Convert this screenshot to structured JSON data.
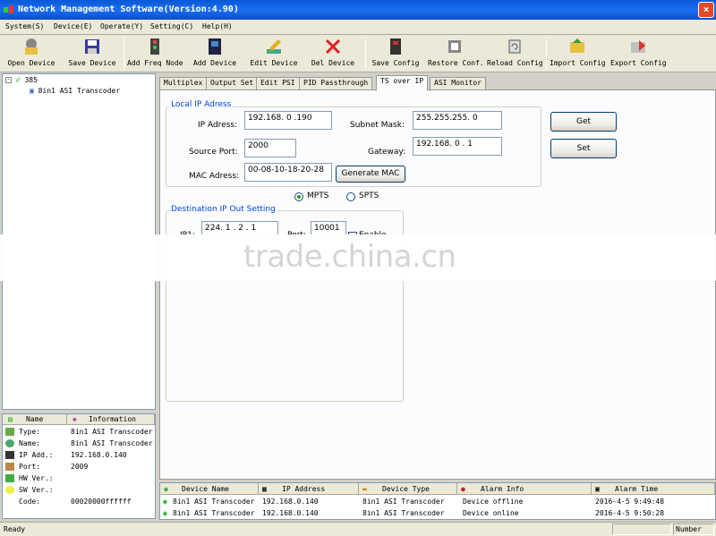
{
  "window": {
    "title": "Network Management Software(Version:4.90)"
  },
  "menu": [
    "System(S)",
    "Device(E)",
    "Operate(Y)",
    "Setting(C)",
    "Help(H)"
  ],
  "toolbar": [
    {
      "label": "Open Device",
      "icon": "folder-open-icon"
    },
    {
      "label": "Save Device",
      "icon": "floppy-disk-icon"
    },
    {
      "label": "Add Freq Node",
      "icon": "add-node-icon"
    },
    {
      "label": "Add Device",
      "icon": "add-device-icon"
    },
    {
      "label": "Edit Device",
      "icon": "edit-icon"
    },
    {
      "label": "Del Device",
      "icon": "delete-x-icon"
    },
    {
      "label": "Save Config",
      "icon": "save-config-icon"
    },
    {
      "label": "Restore Conf.",
      "icon": "restore-icon"
    },
    {
      "label": "Reload Config",
      "icon": "reload-icon"
    },
    {
      "label": "Import Config",
      "icon": "import-folder-icon"
    },
    {
      "label": "Export Config",
      "icon": "export-icon"
    }
  ],
  "tree": {
    "root": "385",
    "child": "8in1 ASI Transcoder"
  },
  "info": {
    "headers": [
      "Name",
      "Information"
    ],
    "rows": [
      {
        "key": "Type:",
        "value": "8in1 ASI Transcoder"
      },
      {
        "key": "Name:",
        "value": "8in1 ASI Transcoder"
      },
      {
        "key": "IP Add.:",
        "value": "192.168.0.140"
      },
      {
        "key": "Port:",
        "value": "2009"
      },
      {
        "key": "HW Ver.:",
        "value": ""
      },
      {
        "key": "SW Ver.:",
        "value": ""
      },
      {
        "key": "Code:",
        "value": "00020000ffffff"
      }
    ]
  },
  "tabs": [
    "Multiplex",
    "Output Set",
    "Edit PSI",
    "PID Passthrough",
    "TS over IP",
    "ASI Monitor"
  ],
  "local_ip": {
    "group_label": "Local IP Adress",
    "ip_label": "IP Adress:",
    "ip_value": "192.168. 0 .190",
    "subnet_label": "Subnet Mask:",
    "subnet_value": "255.255.255. 0",
    "source_port_label": "Source Port:",
    "source_port_value": "2000",
    "gateway_label": "Gateway:",
    "gateway_value": "192.168. 0 . 1",
    "mac_label": "MAC Adress:",
    "mac_value": "00-08-10-18-20-28",
    "generate_mac": "Generate MAC"
  },
  "buttons": {
    "get": "Get",
    "set": "Set"
  },
  "mode": {
    "mpts": "MPTS",
    "spts": "SPTS",
    "selected": "MPTS"
  },
  "dest": {
    "group_label": "Destination IP Out Setting",
    "ip_label": "IP1:",
    "ip_value": "224. 1 . 2 . 1",
    "port_label": "Port:",
    "port_value": "10001",
    "enable_label": "Enable",
    "enabled": true
  },
  "watermark": "trade.china.cn",
  "alarm": {
    "headers": [
      "Device Name",
      "IP Address",
      "Device Type",
      "Alarm Info",
      "Alarm Time"
    ],
    "rows": [
      [
        "8in1 ASI Transcoder",
        "192.168.0.140",
        "8in1 ASI Transcoder",
        "Device offline",
        "2016-4-5 9:49:48"
      ],
      [
        "8in1 ASI Transcoder",
        "192.168.0.140",
        "8in1 ASI Transcoder",
        "Device online",
        "2016-4-5 9:50:28"
      ]
    ]
  },
  "status": {
    "left": "Ready",
    "right": "Number"
  },
  "colors": {
    "titlebar": "#0a58d8",
    "group_label": "#0046d5",
    "chrome": "#ece9d8"
  }
}
